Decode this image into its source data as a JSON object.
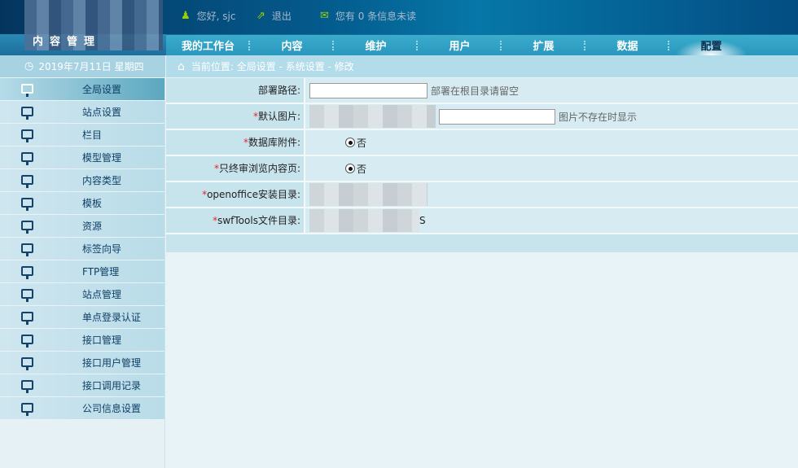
{
  "header": {
    "logo_text": "内容管理",
    "greeting": "您好, sjc",
    "logout": "退出",
    "messages": "您有 0 条信息未读"
  },
  "nav": [
    "我的工作台",
    "内容",
    "维护",
    "用户",
    "扩展",
    "数据",
    "配置"
  ],
  "nav_active": "配置",
  "date": "2019年7月11日  星期四",
  "breadcrumb": "当前位置: 全局设置  - 系统设置  - 修改",
  "sidebar": [
    "全局设置",
    "站点设置",
    "栏目",
    "模型管理",
    "内容类型",
    "模板",
    "资源",
    "标签向导",
    "FTP管理",
    "站点管理",
    "单点登录认证",
    "接口管理",
    "接口用户管理",
    "接口调用记录",
    "公司信息设置"
  ],
  "form": {
    "deploy_path": {
      "label": "部署路径:",
      "hint": "部署在根目录请留空",
      "value": ""
    },
    "default_image": {
      "label": "默认图片:",
      "hint": "图片不存在时显示"
    },
    "db_attachment": {
      "label": "数据库附件:",
      "option": "否"
    },
    "final_review": {
      "label": "只终审浏览内容页:",
      "option": "否"
    },
    "openoffice": {
      "label": "openoffice安装目录:"
    },
    "swftools": {
      "label": "swfTools文件目录:",
      "visible_tail": "S"
    }
  }
}
